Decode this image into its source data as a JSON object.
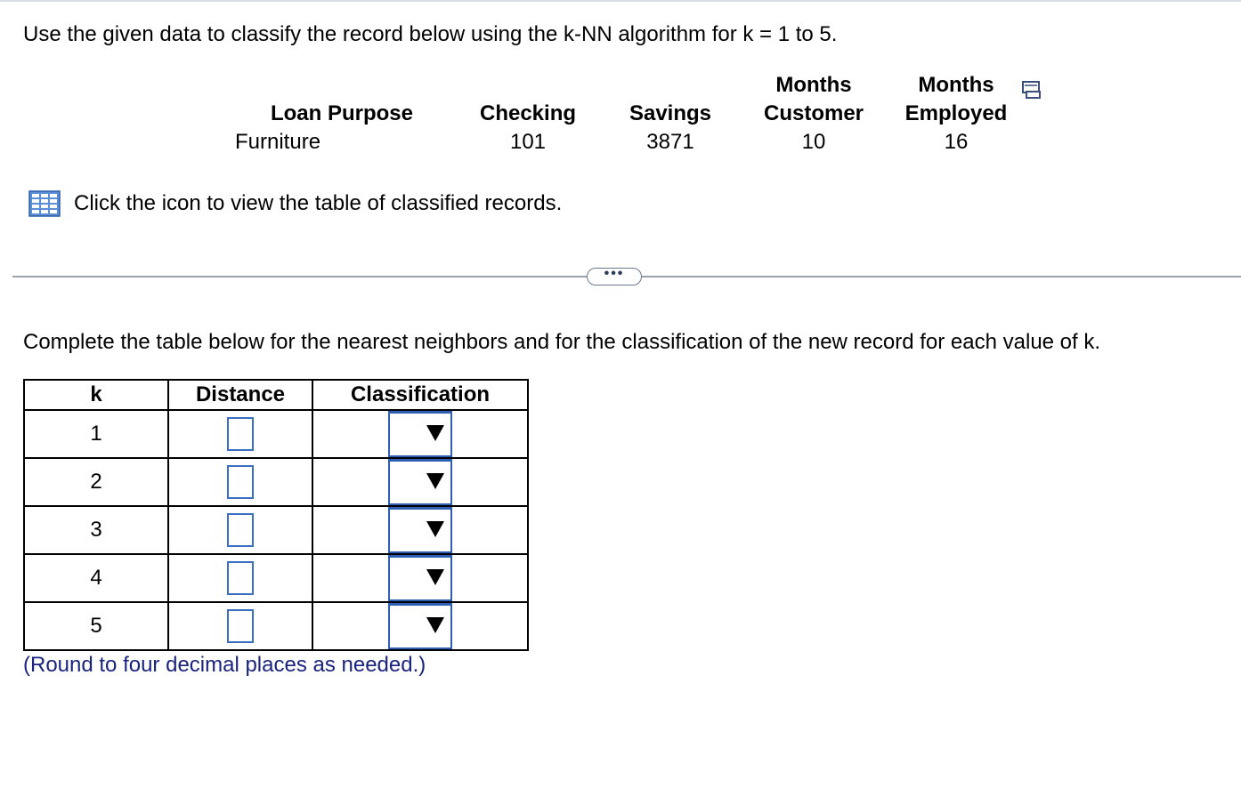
{
  "intro_text": "Use the given data to classify the record below using the k-NN algorithm for k = 1 to 5.",
  "record": {
    "headers": [
      {
        "line1": "",
        "line2": "Loan Purpose"
      },
      {
        "line1": "",
        "line2": "Checking"
      },
      {
        "line1": "",
        "line2": "Savings"
      },
      {
        "line1": "Months",
        "line2": "Customer"
      },
      {
        "line1": "Months",
        "line2": "Employed"
      }
    ],
    "values": [
      "Furniture",
      "101",
      "3871",
      "10",
      "16"
    ]
  },
  "icons": {
    "copy": "copy-icon",
    "table": "table-grid-icon",
    "more": "ellipsis-icon",
    "dropdown": "triangle-down-icon"
  },
  "click_link_text": "Click the icon to view the table of classified records.",
  "more_button_label": "•••",
  "instruction_text": "Complete the table below for the nearest neighbors and for the classification of the new record for each value of k.",
  "answer_table": {
    "headers": [
      "k",
      "Distance",
      "Classification"
    ],
    "rows": [
      {
        "k": "1",
        "distance": "",
        "classification": ""
      },
      {
        "k": "2",
        "distance": "",
        "classification": ""
      },
      {
        "k": "3",
        "distance": "",
        "classification": ""
      },
      {
        "k": "4",
        "distance": "",
        "classification": ""
      },
      {
        "k": "5",
        "distance": "",
        "classification": ""
      }
    ]
  },
  "round_note": "(Round to four decimal places as needed.)",
  "colors": {
    "input_border": "#3a6fc4",
    "select_border": "#2f5fb3",
    "note_text": "#1a237e",
    "divider": "#9aa3ad"
  }
}
